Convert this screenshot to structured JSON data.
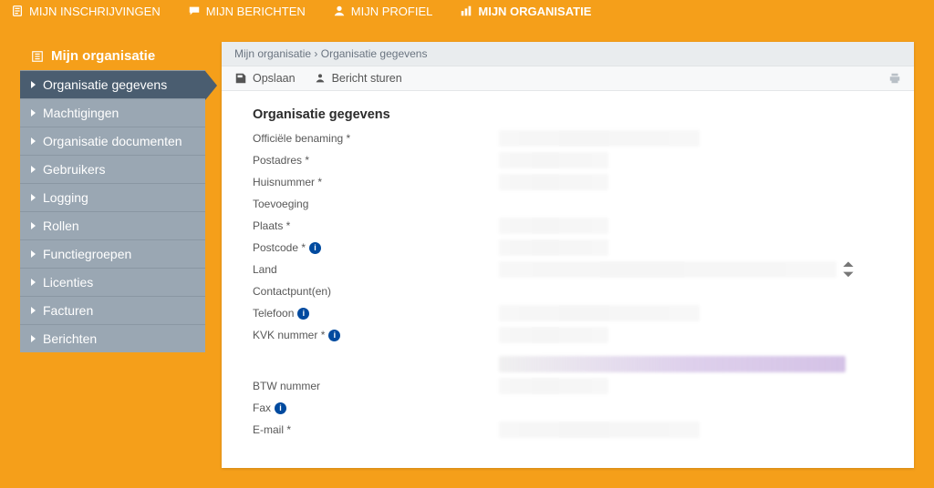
{
  "topnav": {
    "items": [
      {
        "label": "MIJN INSCHRIJVINGEN",
        "icon": "clipboard",
        "active": false
      },
      {
        "label": "MIJN BERICHTEN",
        "icon": "chat",
        "active": false
      },
      {
        "label": "MIJN PROFIEL",
        "icon": "person",
        "active": false
      },
      {
        "label": "MIJN ORGANISATIE",
        "icon": "chart",
        "active": true
      }
    ]
  },
  "sidebar": {
    "group_title": "Mijn organisatie",
    "items": [
      {
        "label": "Organisatie gegevens",
        "active": true
      },
      {
        "label": "Machtigingen",
        "active": false
      },
      {
        "label": "Organisatie documenten",
        "active": false
      },
      {
        "label": "Gebruikers",
        "active": false
      },
      {
        "label": "Logging",
        "active": false
      },
      {
        "label": "Rollen",
        "active": false
      },
      {
        "label": "Functiegroepen",
        "active": false
      },
      {
        "label": "Licenties",
        "active": false
      },
      {
        "label": "Facturen",
        "active": false
      },
      {
        "label": "Berichten",
        "active": false
      }
    ]
  },
  "breadcrumb": {
    "root": "Mijn organisatie",
    "sep": "›",
    "current": "Organisatie gegevens"
  },
  "actions": {
    "save": "Opslaan",
    "send": "Bericht sturen"
  },
  "form": {
    "title": "Organisatie gegevens",
    "fields": {
      "officiele_benaming": "Officiële benaming *",
      "postadres": "Postadres *",
      "huisnummer": "Huisnummer *",
      "toevoeging": "Toevoeging",
      "plaats": "Plaats *",
      "postcode": "Postcode *",
      "land": "Land",
      "contactpunten": "Contactpunt(en)",
      "telefoon": "Telefoon",
      "kvk": "KVK nummer *",
      "btw": "BTW nummer",
      "fax": "Fax",
      "email": "E-mail *"
    }
  }
}
